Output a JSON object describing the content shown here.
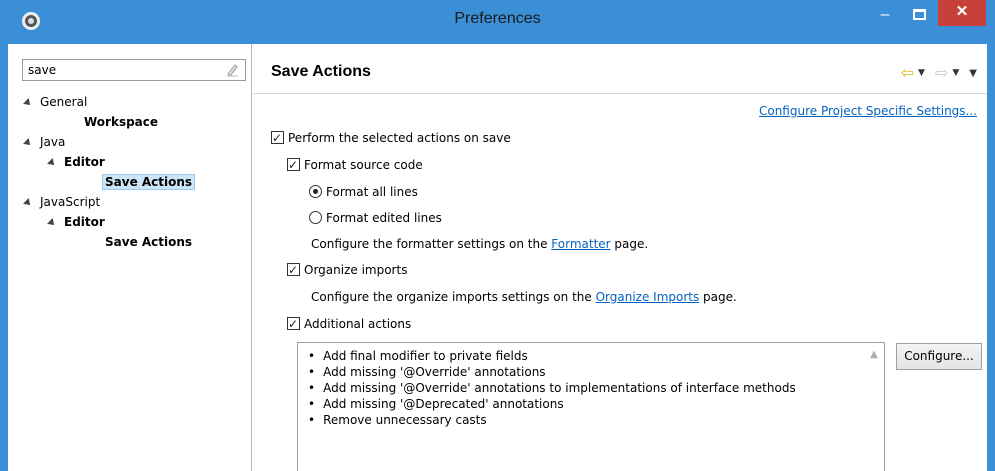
{
  "window": {
    "title": "Preferences",
    "minimize_label": "–",
    "close_label": "✕"
  },
  "filter": {
    "value": "save"
  },
  "tree": {
    "general": "General",
    "workspace": "Workspace",
    "java": "Java",
    "java_editor": "Editor",
    "java_save_actions": "Save Actions",
    "javascript": "JavaScript",
    "js_editor": "Editor",
    "js_save_actions": "Save Actions"
  },
  "page": {
    "title": "Save Actions",
    "configure_project_link": "Configure Project Specific Settings...",
    "perform_actions": "Perform the selected actions on save",
    "format_source": "Format source code",
    "format_all": "Format all lines",
    "format_edited": "Format edited lines",
    "formatter_prefix": "Configure the formatter settings on the ",
    "formatter_link": "Formatter",
    "formatter_suffix": " page.",
    "organize_imports": "Organize imports",
    "organize_prefix": "Configure the organize imports settings on the ",
    "organize_link": "Organize Imports",
    "organize_suffix": " page.",
    "additional_actions": "Additional actions",
    "configure_button": "Configure...",
    "actions": [
      "Add final modifier to private fields",
      "Add missing '@Override' annotations",
      "Add missing '@Override' annotations to implementations of interface methods",
      "Add missing '@Deprecated' annotations",
      "Remove unnecessary casts"
    ]
  },
  "colors": {
    "titlebar": "#3b8fd6",
    "close_button": "#c7413a",
    "link": "#0563c1",
    "selection": "#cde6f7"
  }
}
